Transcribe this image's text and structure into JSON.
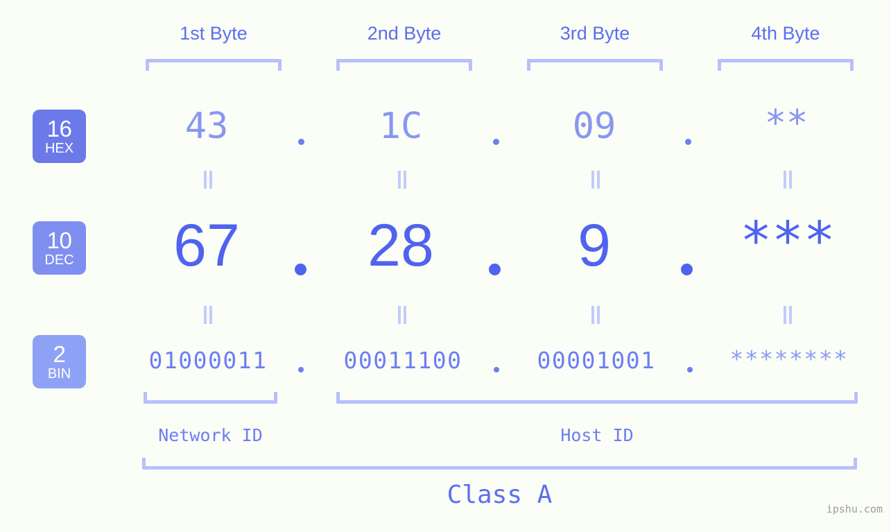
{
  "meta": {
    "background_color": "#fbfdf7",
    "accent_color": "#5b6ef0",
    "bracket_color": "#b7c0fb",
    "watermark": "ipshu.com"
  },
  "byte_headers": [
    {
      "label": "1st Byte"
    },
    {
      "label": "2nd Byte"
    },
    {
      "label": "3rd Byte"
    },
    {
      "label": "4th Byte"
    }
  ],
  "bases": [
    {
      "number": "16",
      "name": "HEX",
      "color": "#6b7ae8"
    },
    {
      "number": "10",
      "name": "DEC",
      "color": "#7f8fef"
    },
    {
      "number": "2",
      "name": "BIN",
      "color": "#8ea2f5"
    }
  ],
  "rows": {
    "hex": {
      "values": [
        "43",
        "1C",
        "09",
        "**"
      ],
      "separator": "."
    },
    "dec": {
      "values": [
        "67",
        "28",
        "9",
        "***"
      ],
      "separator": "."
    },
    "bin": {
      "values": [
        "01000011",
        "00011100",
        "00001001",
        "********"
      ],
      "separator": "."
    }
  },
  "segments": {
    "network_id": "Network ID",
    "host_id": "Host ID",
    "class": "Class A"
  }
}
